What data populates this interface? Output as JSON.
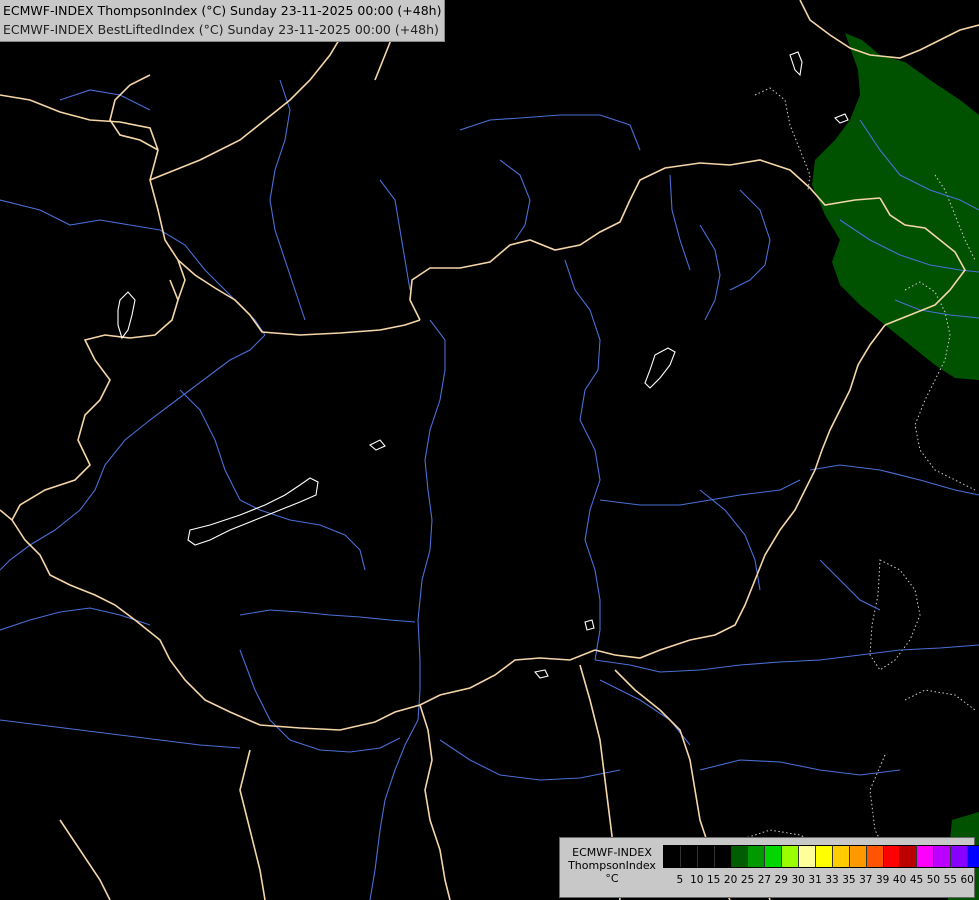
{
  "header": {
    "title_main": "ECMWF-INDEX ThompsonIndex (°C) Sunday 23-11-2025 00:00 (+48h)",
    "title_sub": "ECMWF-INDEX BestLiftedIndex (°C) Sunday 23-11-2025 00:00 (+48h)"
  },
  "legend": {
    "title_line1": "ECMWF-INDEX",
    "title_line2": "ThompsonIndex",
    "unit": "°C",
    "colors": [
      "#000000",
      "#000000",
      "#000000",
      "#000000",
      "#005c00",
      "#009900",
      "#00d600",
      "#99ff00",
      "#ffff99",
      "#ffff00",
      "#ffcc00",
      "#ff9900",
      "#ff5500",
      "#ff0000",
      "#bb0000",
      "#ff00ff",
      "#bb00ff",
      "#8800ff",
      "#0000ff"
    ],
    "ticks": [
      "5",
      "10",
      "15",
      "20",
      "25",
      "27",
      "29",
      "30",
      "31",
      "33",
      "35",
      "37",
      "39",
      "40",
      "45",
      "50",
      "55",
      "60"
    ]
  },
  "colors": {
    "background": "#000000",
    "borders": "#f5d6a8",
    "rivers": "#4a6fd6",
    "lakes": "#ffffff",
    "thompson_fill": "#005200",
    "lifted_index_contour": "#d8d8d8"
  }
}
